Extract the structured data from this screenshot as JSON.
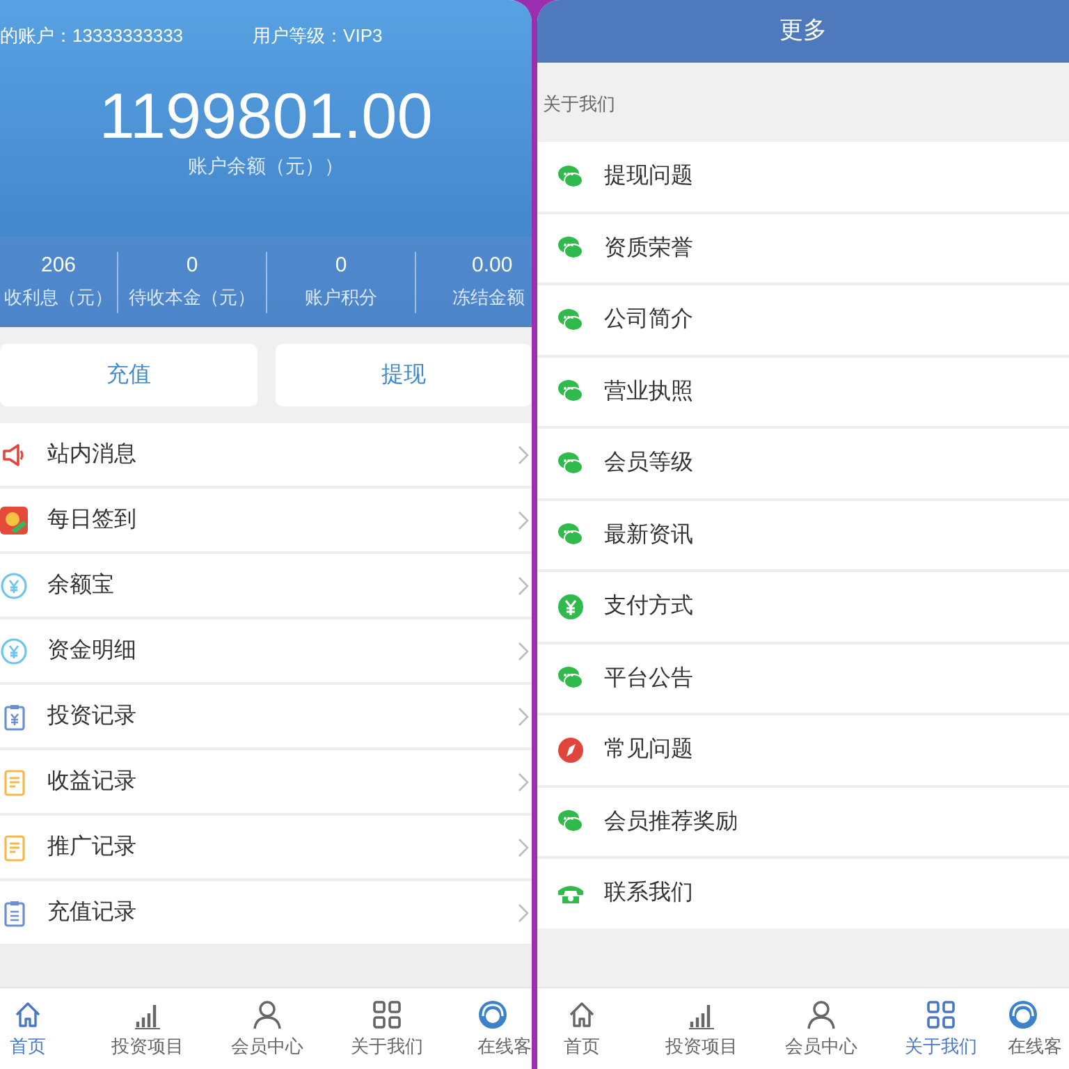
{
  "account_screen": {
    "account": "的账户：13333333333",
    "level": "用户等级：VIP3",
    "balance": "1199801.00",
    "balance_label": "账户余额（元））",
    "stats": [
      {
        "value": "206",
        "label": "收利息（元）"
      },
      {
        "value": "0",
        "label": "待收本金（元）"
      },
      {
        "value": "0",
        "label": "账户积分"
      },
      {
        "value": "0.00",
        "label": "冻结金额"
      }
    ],
    "buttons": [
      "充值",
      "提现"
    ],
    "menu": [
      {
        "label": "站内消息"
      },
      {
        "label": "每日签到"
      },
      {
        "label": "余额宝"
      },
      {
        "label": "资金明细"
      },
      {
        "label": "投资记录"
      },
      {
        "label": "收益记录"
      },
      {
        "label": "推广记录"
      },
      {
        "label": "充值记录"
      }
    ],
    "tab_bar": [
      {
        "label": "首页",
        "selected": true
      },
      {
        "label": "投资项目",
        "selected": false
      },
      {
        "label": "会员中心",
        "selected": false
      },
      {
        "label": "关于我们",
        "selected": false
      },
      {
        "label": "在线客",
        "selected": false
      }
    ]
  },
  "more_screen": {
    "title": "更多",
    "section": "关于我们",
    "menu": [
      {
        "label": "提现问题"
      },
      {
        "label": "资质荣誉"
      },
      {
        "label": "公司简介"
      },
      {
        "label": "营业执照"
      },
      {
        "label": "会员等级"
      },
      {
        "label": "最新资讯"
      },
      {
        "label": "支付方式"
      },
      {
        "label": "平台公告"
      },
      {
        "label": "常见问题"
      },
      {
        "label": "会员推荐奖励"
      },
      {
        "label": "联系我们"
      }
    ],
    "tab_bar": [
      {
        "label": "首页",
        "selected": false
      },
      {
        "label": "投资项目",
        "selected": false
      },
      {
        "label": "会员中心",
        "selected": false
      },
      {
        "label": "关于我们",
        "selected": true
      },
      {
        "label": "在线客",
        "selected": false
      }
    ]
  }
}
